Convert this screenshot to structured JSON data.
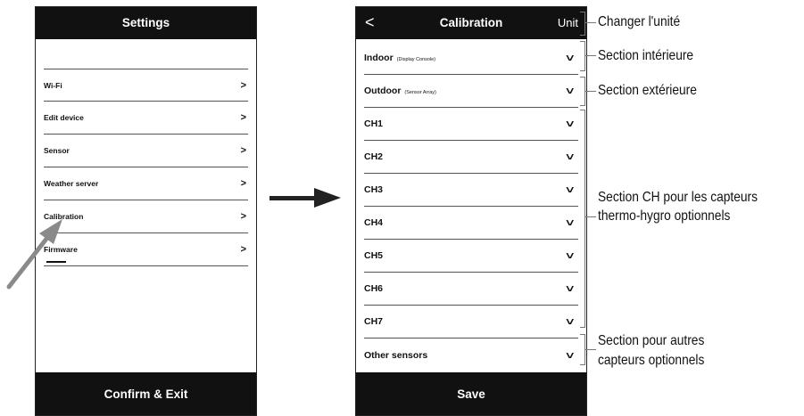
{
  "left_screen": {
    "title": "Settings",
    "items": [
      {
        "label": "Wi-Fi"
      },
      {
        "label": "Edit device"
      },
      {
        "label": "Sensor"
      },
      {
        "label": "Weather server"
      },
      {
        "label": "Calibration"
      },
      {
        "label": "Firmware"
      }
    ],
    "footer_label": "Confirm & Exit",
    "chevron": ">"
  },
  "right_screen": {
    "back_glyph": "<",
    "title": "Calibration",
    "unit_label": "Unit",
    "sections": [
      {
        "label": "Indoor",
        "sublabel": "(Display Console)"
      },
      {
        "label": "Outdoor",
        "sublabel": "(Sensor Array)"
      },
      {
        "label": "CH1",
        "sublabel": ""
      },
      {
        "label": "CH2",
        "sublabel": ""
      },
      {
        "label": "CH3",
        "sublabel": ""
      },
      {
        "label": "CH4",
        "sublabel": ""
      },
      {
        "label": "CH5",
        "sublabel": ""
      },
      {
        "label": "CH6",
        "sublabel": ""
      },
      {
        "label": "CH7",
        "sublabel": ""
      },
      {
        "label": "Other sensors",
        "sublabel": ""
      }
    ],
    "footer_label": "Save",
    "chevron": ">"
  },
  "annotations": {
    "unit": "Changer l'unité",
    "indoor": "Section intérieure",
    "outdoor": "Section extérieure",
    "ch_line1": "Section CH pour les capteurs",
    "ch_line2": "thermo-hygro optionnels",
    "other_line1": "Section pour autres",
    "other_line2": "capteurs optionnels"
  },
  "colors": {
    "bar": "#111111",
    "text": "#111111",
    "bracket": "#777777",
    "pointer_arrow": "#8a8a8a"
  }
}
